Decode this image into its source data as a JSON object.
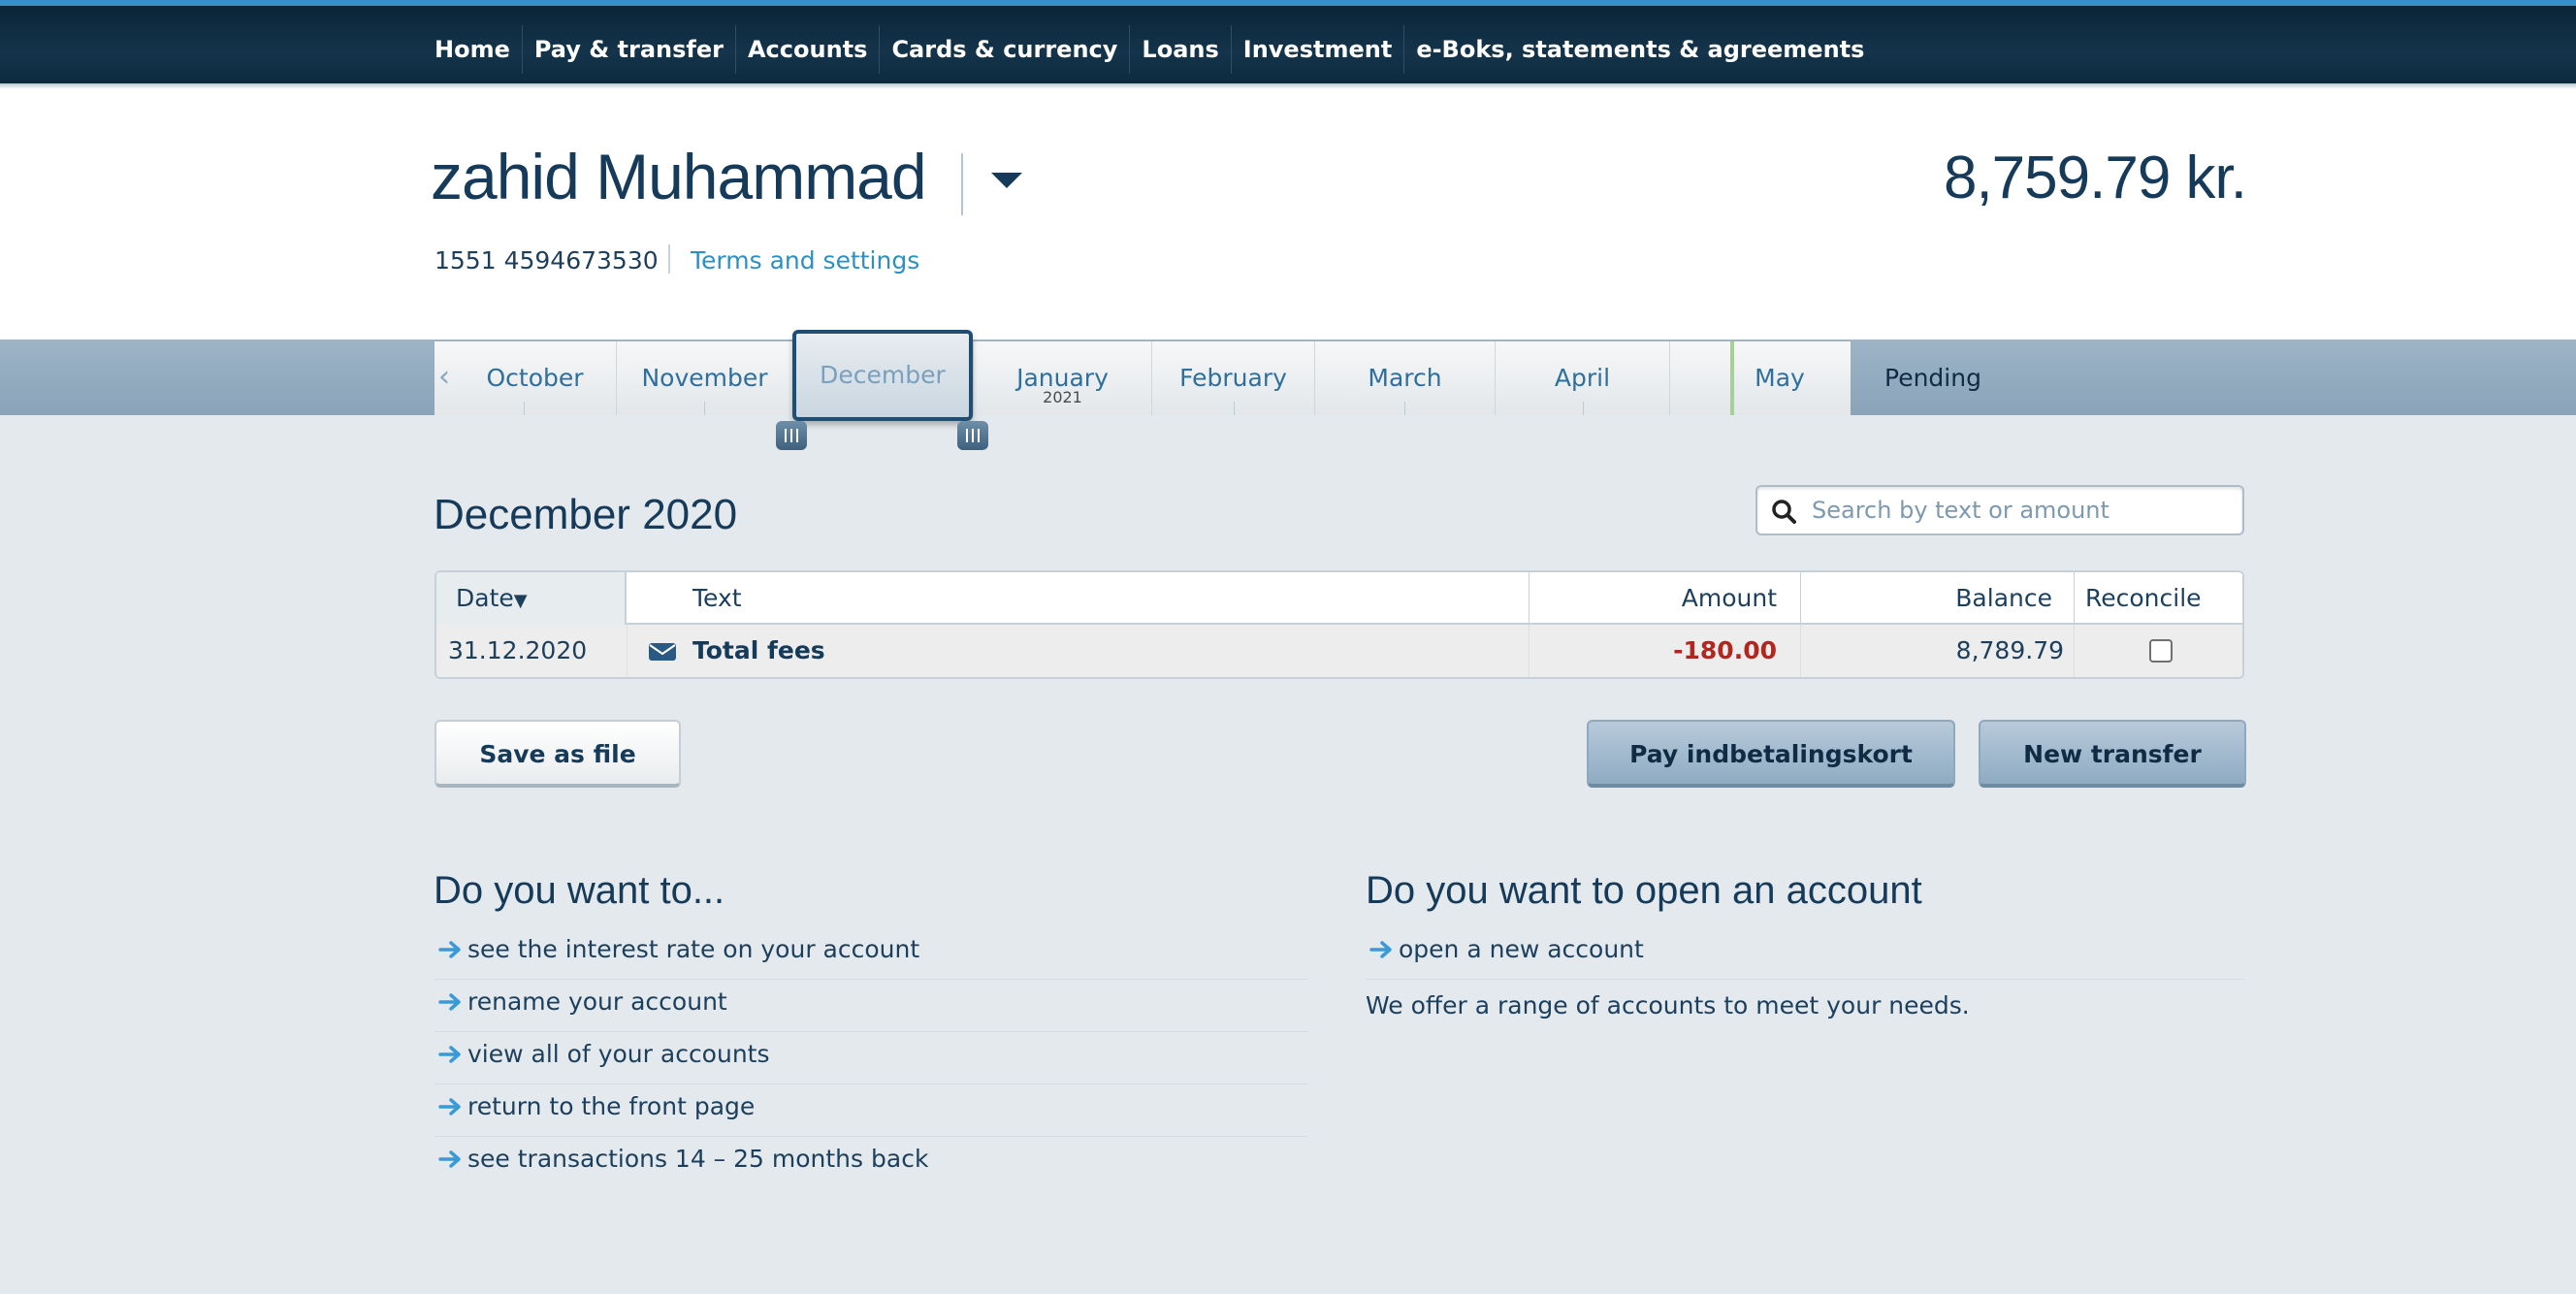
{
  "nav": {
    "items": [
      {
        "label": "Home"
      },
      {
        "label": "Pay & transfer"
      },
      {
        "label": "Accounts"
      },
      {
        "label": "Cards & currency"
      },
      {
        "label": "Loans"
      },
      {
        "label": "Investment"
      },
      {
        "label": "e-Boks, statements & agreements"
      }
    ]
  },
  "account": {
    "name": "zahid Muhammad",
    "balance": "8,759.79 kr.",
    "number": "1551 4594673530",
    "terms_link": "Terms and settings"
  },
  "months": {
    "tabs": [
      {
        "label": "October"
      },
      {
        "label": "November"
      },
      {
        "label": "December"
      },
      {
        "label": "January",
        "sub": "2021"
      },
      {
        "label": "February"
      },
      {
        "label": "March"
      },
      {
        "label": "April"
      },
      {
        "label": "May"
      }
    ],
    "selected": "December",
    "pending_label": "Pending"
  },
  "main": {
    "title": "December 2020",
    "search_placeholder": "Search by text or amount"
  },
  "table": {
    "headers": {
      "date": "Date",
      "text": "Text",
      "amount": "Amount",
      "balance": "Balance",
      "reconcile": "Reconcile"
    },
    "sort_indicator": "▼",
    "rows": [
      {
        "date": "31.12.2020",
        "text": "Total fees",
        "amount": "-180.00",
        "balance": "8,789.79",
        "reconciled": false
      }
    ]
  },
  "buttons": {
    "save_file": "Save as file",
    "pay_card": "Pay indbetalingskort",
    "new_transfer": "New transfer"
  },
  "want_to": {
    "title": "Do you want to...",
    "links": [
      "see the interest rate on your account",
      "rename your account",
      "view all of your accounts",
      "return to the front page",
      "see transactions 14 – 25 months back"
    ]
  },
  "open_account": {
    "title": "Do you want to open an account",
    "link": "open a new account",
    "description": "We offer a range of accounts to meet your needs."
  },
  "colors": {
    "nav_bg": "#14344b",
    "accent_link": "#2e8fc2",
    "negative_amount": "#b3261e",
    "heading": "#163a59"
  }
}
